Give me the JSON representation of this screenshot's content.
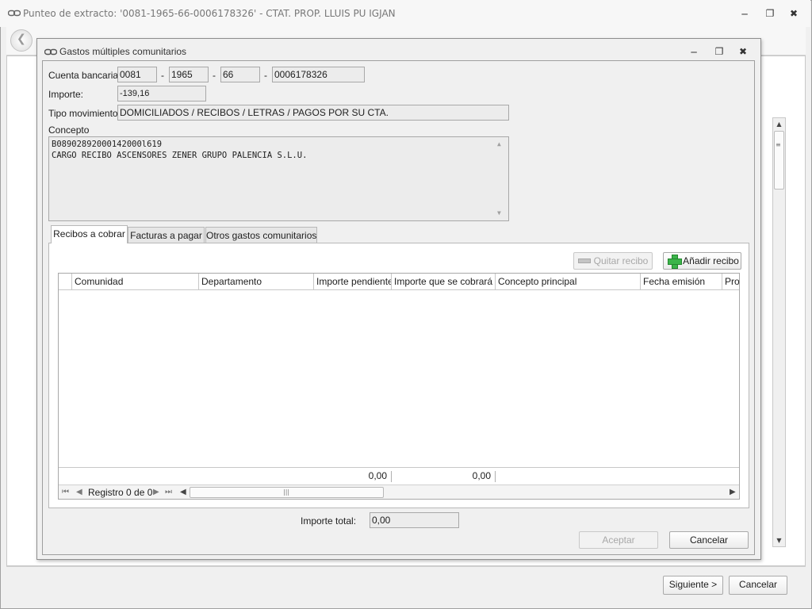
{
  "main": {
    "title": "Punteo de extracto: '0081-1965-66-0006178326' - CTAT. PROP. LLUIS PU IGJAN",
    "icons": {
      "app": "chain-link-icon",
      "back": "arrow-left-icon",
      "minimize": "minimize-icon",
      "restore": "restore-icon",
      "close": "close-icon"
    },
    "footer": {
      "next_label": "Siguiente >",
      "cancel_label": "Cancelar"
    }
  },
  "dialog": {
    "title": "Gastos múltiples comunitarios",
    "bank_account": {
      "label": "Cuenta bancaria:",
      "part1": "0081",
      "part2": "1965",
      "part3": "66",
      "part4": "0006178326",
      "separator": "-"
    },
    "amount": {
      "label": "Importe:",
      "value": "-139,16"
    },
    "movement_type": {
      "label": "Tipo movimiento:",
      "value": "DOMICILIADOS / RECIBOS / LETRAS / PAGOS POR SU CTA."
    },
    "concept": {
      "label": "Concepto",
      "lines": [
        "B08902892000142000l619",
        "CARGO RECIBO ASCENSORES ZENER GRUPO PALENCIA S.L.U."
      ]
    },
    "tabs": [
      {
        "label": "Recibos a cobrar",
        "active": true
      },
      {
        "label": "Facturas a pagar",
        "active": false
      },
      {
        "label": "Otros gastos comunitarios",
        "active": false
      }
    ],
    "toolbar": {
      "remove_label": "Quitar recibo",
      "add_label": "Añadir recibo"
    },
    "grid": {
      "columns": [
        "Comunidad",
        "Departamento",
        "Importe pendiente",
        "Importe que se cobrará",
        "Concepto principal",
        "Fecha emisión",
        "Prop"
      ],
      "rows": [],
      "footer": {
        "pending_total": "0,00",
        "to_collect_total": "0,00"
      },
      "navigator": {
        "record_text": "Registro 0 de 0"
      }
    },
    "total": {
      "label": "Importe total:",
      "value": "0,00"
    },
    "buttons": {
      "accept_label": "Aceptar",
      "cancel_label": "Cancelar"
    }
  }
}
